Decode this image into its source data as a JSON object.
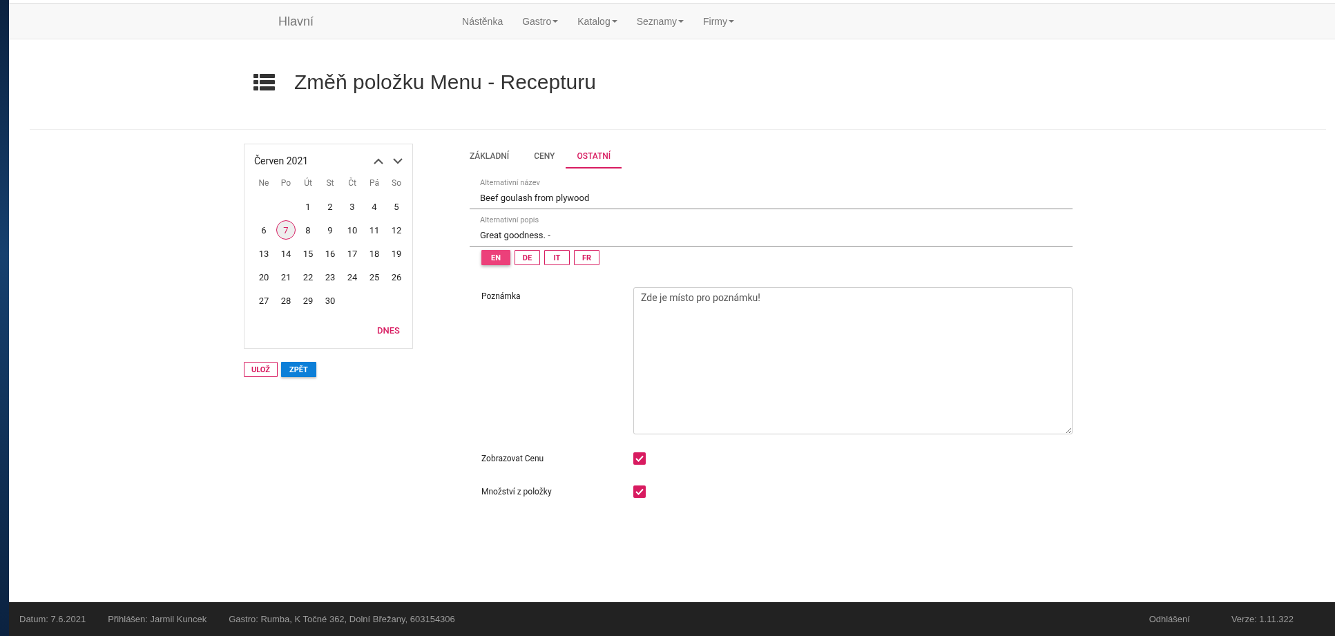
{
  "navbar": {
    "brand": "Hlavní",
    "items": [
      {
        "label": "Nástěnka",
        "dropdown": false
      },
      {
        "label": "Gastro",
        "dropdown": true
      },
      {
        "label": "Katalog",
        "dropdown": true
      },
      {
        "label": "Seznamy",
        "dropdown": true
      },
      {
        "label": "Firmy",
        "dropdown": true
      }
    ]
  },
  "page_title": "Změň položku Menu - Recepturu",
  "calendar": {
    "month": "Červen 2021",
    "weekdays": [
      "Ne",
      "Po",
      "Út",
      "St",
      "Čt",
      "Pá",
      "So"
    ],
    "weeks": [
      [
        {
          "day": "1",
          "selected": false
        },
        {
          "day": "2",
          "selected": false
        },
        {
          "day": "3",
          "selected": false
        },
        {
          "day": "4",
          "selected": false
        },
        {
          "day": "5",
          "selected": false
        }
      ],
      [
        {
          "day": "6",
          "selected": false
        },
        {
          "day": "7",
          "selected": true
        },
        {
          "day": "8",
          "selected": false
        },
        {
          "day": "9",
          "selected": false
        },
        {
          "day": "10",
          "selected": false
        },
        {
          "day": "11",
          "selected": false
        },
        {
          "day": "12",
          "selected": false
        }
      ],
      [
        {
          "day": "13",
          "selected": false
        },
        {
          "day": "14",
          "selected": false
        },
        {
          "day": "15",
          "selected": false
        },
        {
          "day": "16",
          "selected": false
        },
        {
          "day": "17",
          "selected": false
        },
        {
          "day": "18",
          "selected": false
        },
        {
          "day": "19",
          "selected": false
        }
      ],
      [
        {
          "day": "20",
          "selected": false
        },
        {
          "day": "21",
          "selected": false
        },
        {
          "day": "22",
          "selected": false
        },
        {
          "day": "23",
          "selected": false
        },
        {
          "day": "24",
          "selected": false
        },
        {
          "day": "25",
          "selected": false
        },
        {
          "day": "26",
          "selected": false
        }
      ],
      [
        {
          "day": "27",
          "selected": false
        },
        {
          "day": "28",
          "selected": false
        },
        {
          "day": "29",
          "selected": false
        },
        {
          "day": "30",
          "selected": false
        }
      ]
    ],
    "today_button": "DNES"
  },
  "buttons": [
    {
      "label": "ULOŽ",
      "kind": "outline"
    },
    {
      "label": "ZPĚT",
      "kind": "primary"
    }
  ],
  "tabs": [
    {
      "label": "ZÁKLADNÍ",
      "selected": false
    },
    {
      "label": "CENY",
      "selected": false
    },
    {
      "label": "OSTATNÍ",
      "selected": true
    }
  ],
  "fields": [
    {
      "label": "Alternativní název",
      "value": "Beef goulash from plywood"
    },
    {
      "label": "Alternativní popis",
      "value": "Great goodness. -"
    }
  ],
  "languages": [
    {
      "label": "EN",
      "selected": true
    },
    {
      "label": "DE",
      "selected": false
    },
    {
      "label": "IT",
      "selected": false
    },
    {
      "label": "FR",
      "selected": false
    }
  ],
  "note": {
    "label": "Poznámka",
    "value": "Zde je místo pro poznámku!"
  },
  "checkboxes": [
    {
      "label": "Zobrazovat Cenu",
      "checked": true
    },
    {
      "label": "Množství z položky",
      "checked": true
    }
  ],
  "footer": {
    "left": [
      "Datum: 7.6.2021",
      "Přihlášen: Jarmil Kuncek",
      "Gastro: Rumba, K Točné 362, Dolní Břežany, 603154306"
    ],
    "logout": "Odhlášení",
    "version": "Verze: 1.11.322"
  }
}
